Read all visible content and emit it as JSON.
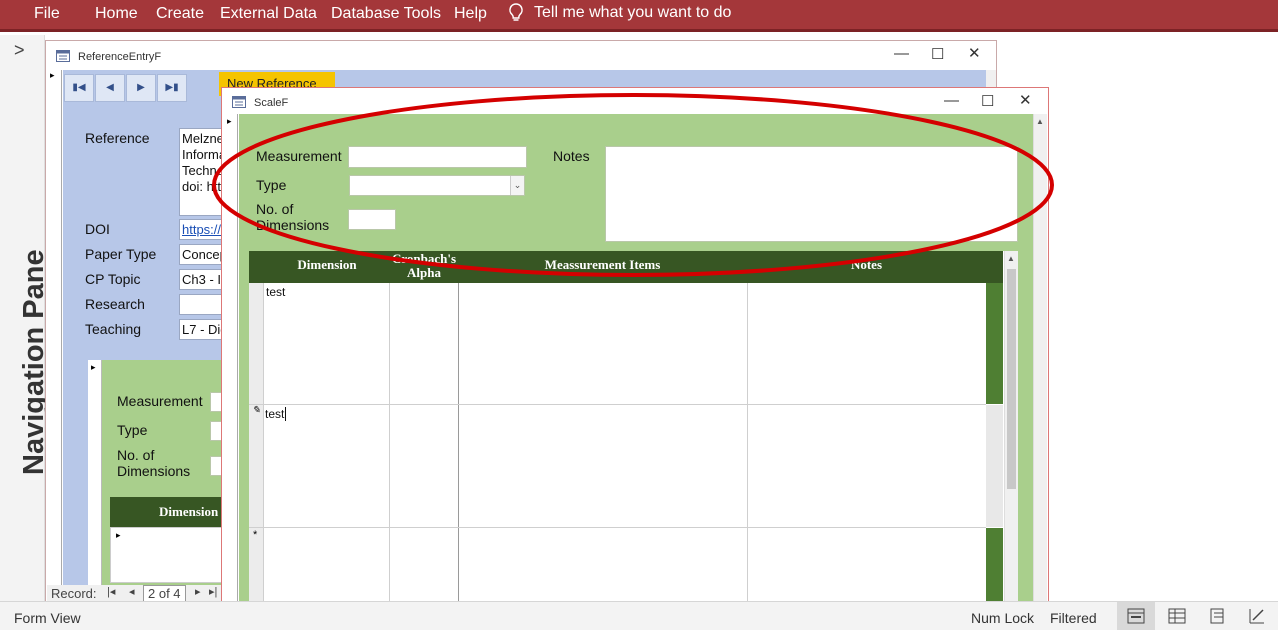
{
  "ribbon": {
    "tabs": [
      "File",
      "Home",
      "Create",
      "External Data",
      "Database Tools",
      "Help"
    ],
    "tell_me": "Tell me what you want to do",
    "icons": {
      "tell_me": "lightbulb-icon"
    },
    "colors": {
      "ribbon": "#a4373a"
    }
  },
  "nav_pane": {
    "title": "Navigation Pane"
  },
  "ref_window": {
    "title": "ReferenceEntryF",
    "new_reference_label": "New Reference",
    "labels": {
      "reference": "Reference",
      "doi": "DOI",
      "paper_type": "Paper Type",
      "cp_topic": "CP Topic",
      "research": "Research",
      "teaching": "Teaching"
    },
    "values": {
      "reference_lines": [
        "Melzne",
        "Informa",
        "Techno",
        "doi: htt"
      ],
      "doi": "https://",
      "paper_type": "Concep",
      "cp_topic": "Ch3 - I",
      "research": "",
      "teaching": "L7 - Dig"
    },
    "subform": {
      "measurement_label": "Measurement",
      "type_label": "Type",
      "dimensions_label_1": "No. of",
      "dimensions_label_2": "Dimensions",
      "dimension_header": "Dimension"
    },
    "record_nav": {
      "label": "Record:",
      "position": "2 of 4"
    }
  },
  "scale_window": {
    "title": "ScaleF",
    "form": {
      "measurement_label": "Measurement",
      "measurement_value": "",
      "type_label": "Type",
      "type_value": "",
      "dimensions_label_1": "No. of",
      "dimensions_label_2": "Dimensions",
      "dimensions_value": "",
      "notes_label": "Notes",
      "notes_value": ""
    },
    "grid": {
      "headers": {
        "dimension": "Dimension",
        "alpha_1": "Cronbach's",
        "alpha_2": "Alpha",
        "items": "Meassurement Items",
        "notes": "Notes"
      },
      "rows": [
        {
          "dimension": "test",
          "alpha": "",
          "items": "",
          "notes": "",
          "selector": ""
        },
        {
          "dimension": "test",
          "alpha": "",
          "items": "",
          "notes": "",
          "selector": "pencil"
        },
        {
          "dimension": "",
          "alpha": "",
          "items": "",
          "notes": "",
          "selector": "*"
        }
      ]
    },
    "colors": {
      "form_bg": "#a9cf8c",
      "grid_header": "#375623",
      "highlight_ellipse": "#d40000"
    }
  },
  "status_bar": {
    "view": "Form View",
    "num_lock": "Num Lock",
    "filtered": "Filtered"
  }
}
